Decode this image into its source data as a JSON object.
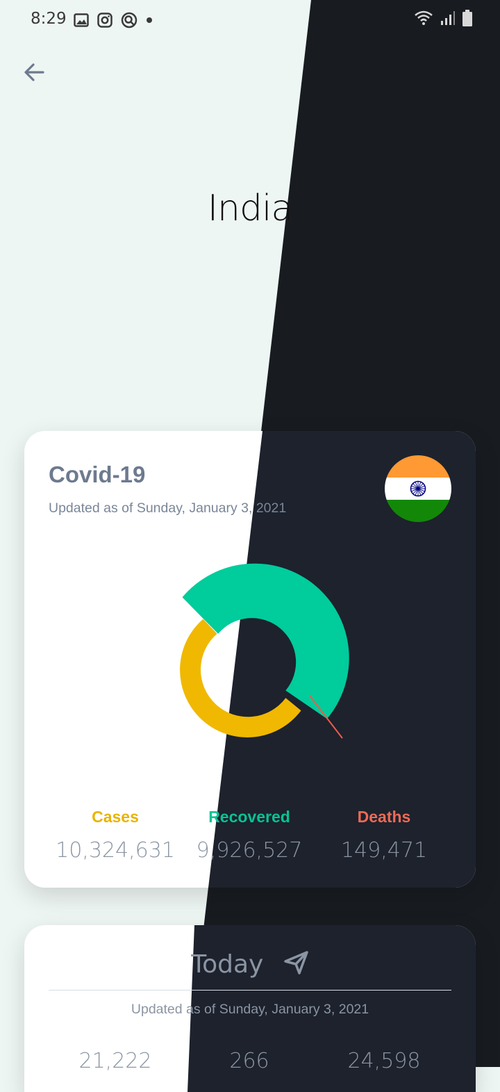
{
  "status_bar": {
    "time": "8:29",
    "icons": [
      "gallery-icon",
      "instagram-icon",
      "app-icon",
      "dot-icon",
      "wifi-icon",
      "signal-icon",
      "battery-icon"
    ]
  },
  "header": {
    "country": "India"
  },
  "summary_card": {
    "title": "Covid-19",
    "subtitle": "Updated as of Sunday, January 3, 2021",
    "stats": [
      {
        "label": "Cases",
        "value": "10,324,631",
        "color": "#e9b400"
      },
      {
        "label": "Recovered",
        "value": "9,926,527",
        "color": "#07c394"
      },
      {
        "label": "Deaths",
        "value": "149,471",
        "color": "#ee6a55"
      }
    ],
    "colors": {
      "cases": "#f0b800",
      "recovered": "#00cc9c",
      "deaths": "#ef5b4b"
    }
  },
  "today_card": {
    "title": "Today",
    "subtitle": "Updated as of Sunday, January 3, 2021",
    "values": [
      "21,222",
      "266",
      "24,598"
    ]
  }
}
